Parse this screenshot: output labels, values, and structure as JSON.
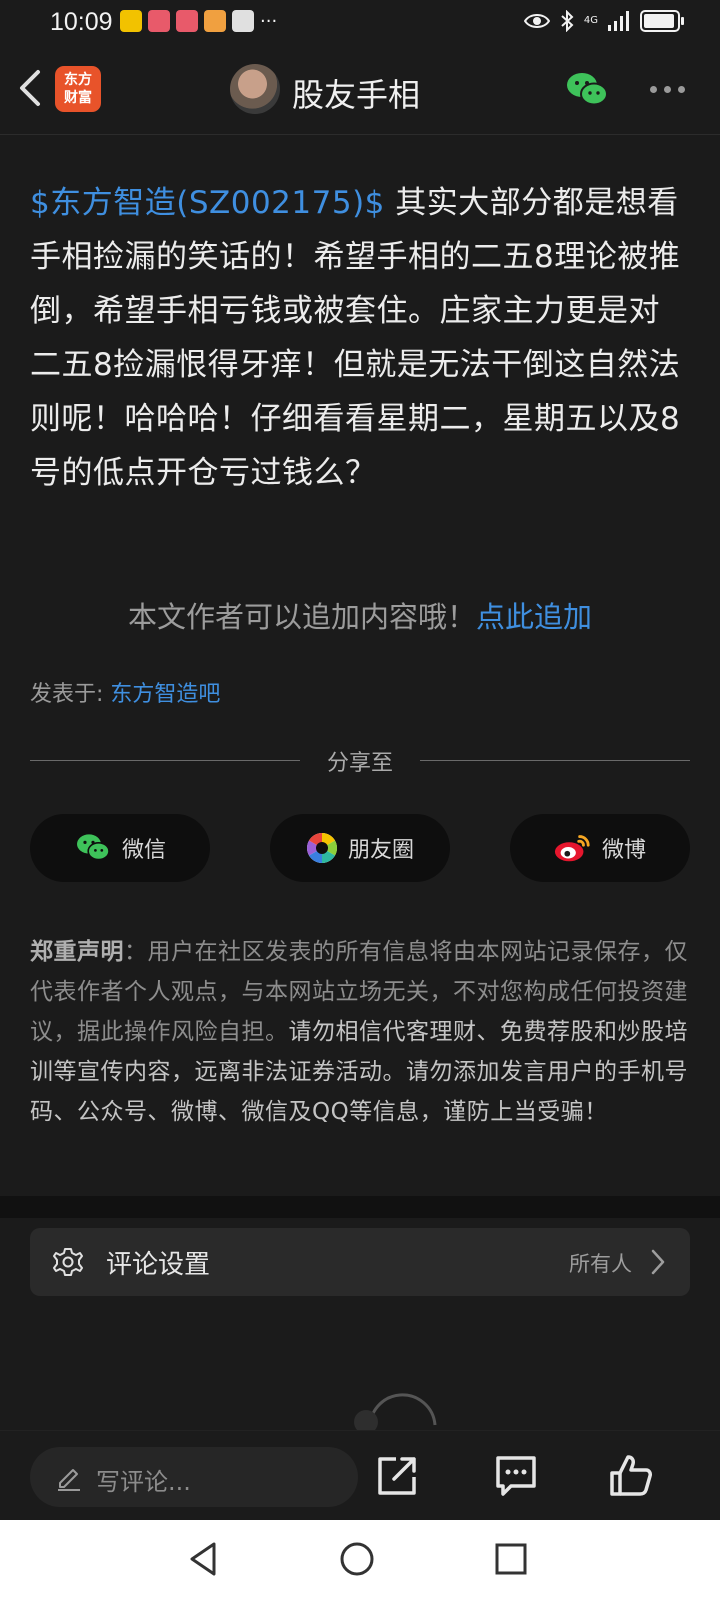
{
  "status": {
    "time": "10:09",
    "more": "···",
    "network": "4G"
  },
  "header": {
    "app_logo_line1": "东方",
    "app_logo_line2": "财富",
    "title": "股友手相"
  },
  "post": {
    "stock_tag": "$东方智造(SZ002175)$",
    "body": " 其实大部分都是想看手相捡漏的笑话的！希望手相的二五8理论被推倒，希望手相亏钱或被套住。庄家主力更是对二五8捡漏恨得牙痒！但就是无法干倒这自然法则呢！哈哈哈！仔细看看星期二，星期五以及8号的低点开仓亏过钱么？"
  },
  "append": {
    "text": "本文作者可以追加内容哦！",
    "link": "点此追加"
  },
  "posted_in": {
    "label": "发表于: ",
    "forum": "东方智造吧"
  },
  "share": {
    "label": "分享至",
    "buttons": [
      {
        "label": "微信"
      },
      {
        "label": "朋友圈"
      },
      {
        "label": "微博"
      }
    ]
  },
  "disclaimer": {
    "label": "郑重声明",
    "colon": "：",
    "text": "用户在社区发表的所有信息将由本网站记录保存，仅代表作者个人观点，与本网站立场无关，不对您构成任何投资建议，据此操作风险自担。",
    "warning": "请勿相信代客理财、免费荐股和炒股培训等宣传内容，远离非法证券活动。请勿添加发言用户的手机号码、公众号、微博、微信及QQ等信息，谨防上当受骗！"
  },
  "comment_settings": {
    "label": "评论设置",
    "value": "所有人"
  },
  "bottom_bar": {
    "comment_placeholder": "写评论..."
  },
  "colors": {
    "accent": "#3f8fe0",
    "background": "#1b1b1b",
    "wechat_green": "#3ec25a",
    "brand_orange": "#e8532a"
  },
  "icons": [
    "back-icon",
    "wechat-icon",
    "more-icon",
    "gear-icon",
    "chevron-right-icon",
    "pencil-icon",
    "share-icon",
    "comment-icon",
    "like-icon",
    "moments-icon",
    "weibo-icon"
  ]
}
